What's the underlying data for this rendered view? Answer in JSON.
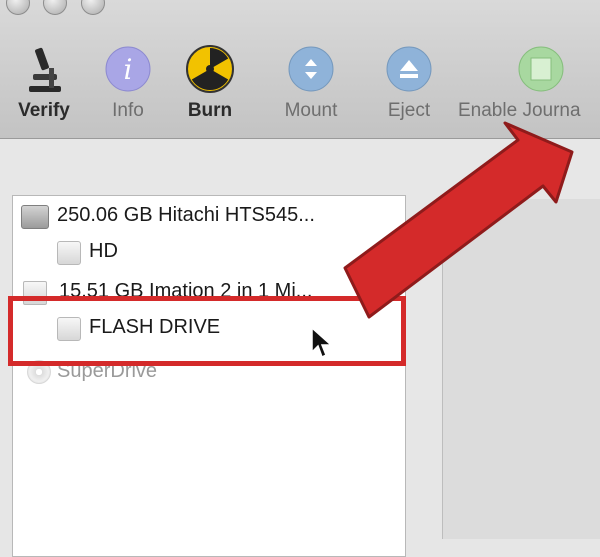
{
  "toolbar": {
    "buttons": [
      {
        "label": "Verify",
        "icon": "microscope-icon",
        "state": "enabled"
      },
      {
        "label": "Info",
        "icon": "info-icon",
        "state": "disabled"
      },
      {
        "label": "Burn",
        "icon": "radiation-icon",
        "state": "enabled"
      },
      {
        "label": "Mount",
        "icon": "mount-icon",
        "state": "disabled"
      },
      {
        "label": "Eject",
        "icon": "eject-icon",
        "state": "disabled"
      },
      {
        "label": "Enable Journa",
        "icon": "enable-journaling-icon",
        "state": "disabled"
      }
    ]
  },
  "sidebar": {
    "items": [
      {
        "text": "250.06 GB Hitachi HTS545...",
        "type": "disk"
      },
      {
        "text": "HD",
        "type": "volume"
      },
      {
        "text": "15.51 GB Imation 2 in 1 Mi...",
        "type": "disk"
      },
      {
        "text": "FLASH DRIVE",
        "type": "volume",
        "selected": true
      },
      {
        "text": "SuperDrive",
        "type": "optical"
      }
    ]
  },
  "colors": {
    "highlight": "#d42a2a",
    "arrow": "#d42a2a"
  }
}
